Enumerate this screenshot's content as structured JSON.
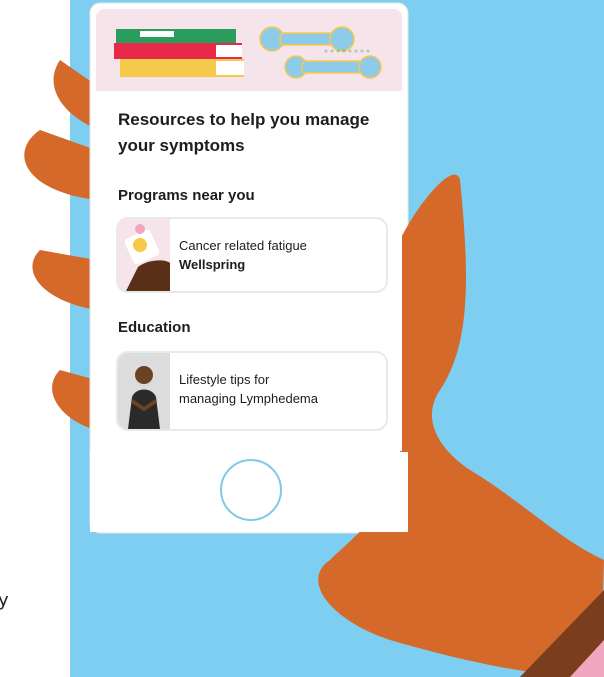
{
  "screen": {
    "headline": "Resources to help you manage your symptoms",
    "sections": [
      {
        "label": "Programs near you",
        "card": {
          "line1": "Cancer related fatigue",
          "line2": "Wellspring"
        }
      },
      {
        "label": "Education",
        "card": {
          "line1": "Lifestyle tips for",
          "line2": "managing Lymphedema"
        }
      }
    ]
  },
  "cutoff_text": "y",
  "colors": {
    "background_blue": "#7dcef0",
    "hand": "#d4692a",
    "sleeve": "#7a3e1c",
    "banner_pink": "#f5e4ea",
    "accent_red": "#e8294a",
    "accent_yellow": "#f7c94a",
    "accent_green": "#2a9d5c",
    "weight_blue": "#8ecbe8"
  },
  "icons": {
    "banner": "books-and-dumbbells-illustration",
    "card1_thumb": "hand-holding-pill-illustration",
    "card2_thumb": "woman-meditating-photo",
    "home": "home-button"
  }
}
